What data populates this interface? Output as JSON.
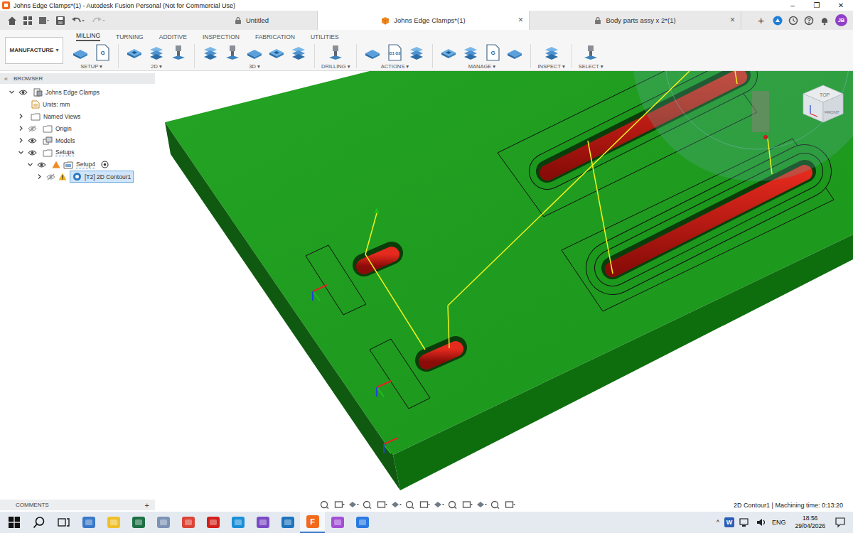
{
  "window": {
    "title": "Johns Edge Clamps*(1) - Autodesk Fusion Personal (Not for Commercial Use)",
    "controls": [
      "–",
      "❐",
      "✕"
    ]
  },
  "doc_tabs": [
    {
      "label": "Untitled",
      "selected": false,
      "closable": false,
      "locked": true
    },
    {
      "label": "Johns Edge Clamps*(1)",
      "selected": true,
      "closable": true,
      "locked": false
    },
    {
      "label": "Body parts assy x 2*(1)",
      "selected": false,
      "closable": true,
      "locked": true
    }
  ],
  "close_glyph": "×",
  "new_tab": "+",
  "avatar": "JB",
  "workspace": {
    "label": "MANUFACTURE",
    "arrow": "▾"
  },
  "ribbon_tabs": [
    {
      "label": "MILLING",
      "selected": true
    },
    {
      "label": "TURNING",
      "selected": false
    },
    {
      "label": "ADDITIVE",
      "selected": false
    },
    {
      "label": "INSPECTION",
      "selected": false
    },
    {
      "label": "FABRICATION",
      "selected": false
    },
    {
      "label": "UTILITIES",
      "selected": false
    }
  ],
  "groups": [
    {
      "label": "SETUP ▾",
      "tools": [
        "",
        "G"
      ]
    },
    {
      "label": "2D ▾",
      "tools": [
        "",
        "",
        ""
      ]
    },
    {
      "label": "3D ▾",
      "tools": [
        "",
        "",
        "",
        "",
        ""
      ]
    },
    {
      "label": "DRILLING ▾",
      "tools": [
        ""
      ]
    },
    {
      "label": "ACTIONS ▾",
      "tools": [
        "",
        "G1 G2",
        ""
      ]
    },
    {
      "label": "MANAGE ▾",
      "tools": [
        "",
        "",
        "G",
        ""
      ]
    },
    {
      "label": "INSPECT ▾",
      "tools": [
        ""
      ]
    },
    {
      "label": "SELECT ▾",
      "tools": [
        ""
      ]
    }
  ],
  "browser": {
    "title": "BROWSER",
    "collapse": "«",
    "items": [
      {
        "label": "Johns Edge Clamps",
        "depth": 0,
        "kind": "document",
        "expandable": true,
        "expanded": true,
        "eye": "shown",
        "selected": false,
        "active": false,
        "warning": false
      },
      {
        "label": "Units: mm",
        "depth": 1,
        "kind": "units",
        "expandable": false,
        "expanded": false,
        "eye": "none",
        "selected": false,
        "active": false,
        "warning": false
      },
      {
        "label": "Named Views",
        "depth": 1,
        "kind": "folder",
        "expandable": true,
        "expanded": false,
        "eye": "none",
        "selected": false,
        "active": false,
        "warning": false
      },
      {
        "label": "Origin",
        "depth": 1,
        "kind": "folder",
        "expandable": true,
        "expanded": false,
        "eye": "hidden",
        "selected": false,
        "active": false,
        "warning": false
      },
      {
        "label": "Models",
        "depth": 1,
        "kind": "models",
        "expandable": true,
        "expanded": false,
        "eye": "shown",
        "selected": false,
        "active": false,
        "warning": false
      },
      {
        "label": "Setups",
        "depth": 1,
        "kind": "folder",
        "expandable": true,
        "expanded": true,
        "eye": "shown",
        "selected": false,
        "active": true,
        "warning": false
      },
      {
        "label": "Setup4",
        "depth": 2,
        "kind": "setup",
        "expandable": true,
        "expanded": true,
        "eye": "shown",
        "selected": false,
        "active": true,
        "warning": false
      },
      {
        "label": "[T2] 2D Contour1",
        "depth": 3,
        "kind": "operation",
        "expandable": true,
        "expanded": false,
        "eye": "hidden",
        "selected": true,
        "active": false,
        "warning": true
      }
    ]
  },
  "viewcube": {
    "top": "TOP",
    "front": "FRONT"
  },
  "comments": {
    "label": "COMMENTS",
    "add": "+"
  },
  "status": "2D Contour1 | Machining time: 0:13:20",
  "taskbar": {
    "apps": [
      {
        "color": "#3a78c9",
        "text": "",
        "active": false
      },
      {
        "color": "#f0c02a",
        "text": "",
        "active": false
      },
      {
        "color": "#1e7145",
        "text": "",
        "active": false
      },
      {
        "color": "#7d93b5",
        "text": "",
        "active": false
      },
      {
        "color": "#db4437",
        "text": "",
        "active": false
      },
      {
        "color": "#d3201a",
        "text": "",
        "active": false
      },
      {
        "color": "#1b8fd8",
        "text": "",
        "active": false
      },
      {
        "color": "#7b4bc4",
        "text": "",
        "active": false
      },
      {
        "color": "#1e73be",
        "text": "",
        "active": false
      },
      {
        "color": "#f26b1d",
        "text": "F",
        "active": true
      },
      {
        "color": "#a34fd6",
        "text": "",
        "active": false
      },
      {
        "color": "#2a7ae2",
        "text": "",
        "active": false
      }
    ],
    "tray": {
      "chevron": "^",
      "word": "W",
      "lang": "ENG",
      "time": "18:56",
      "date": "29/04/2026"
    }
  }
}
